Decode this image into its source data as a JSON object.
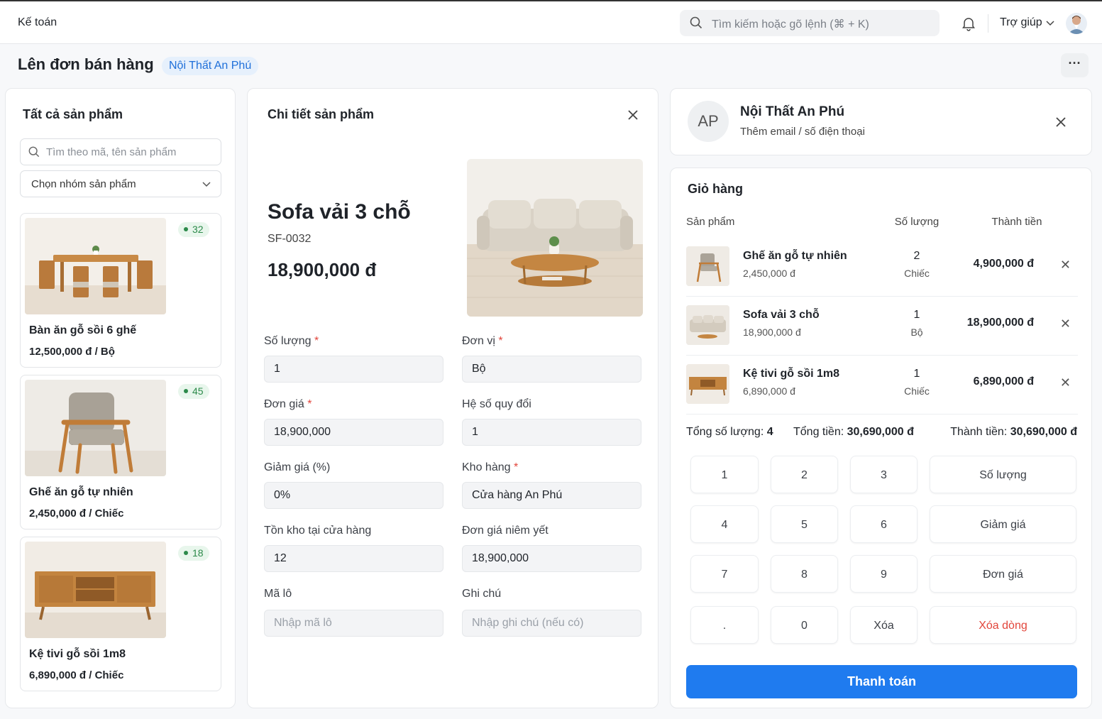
{
  "app": {
    "title": "Kế toán"
  },
  "search": {
    "placeholder": "Tìm kiếm hoặc gõ lệnh (⌘ + K)"
  },
  "help": {
    "label": "Trợ giúp"
  },
  "page": {
    "title": "Lên đơn bán hàng",
    "tag": "Nội Thất An Phú",
    "more": "···"
  },
  "products": {
    "title": "Tất cả sản phẩm",
    "search_placeholder": "Tìm theo mã, tên sản phẩm",
    "group_select": "Chọn nhóm sản phẩm",
    "items": [
      {
        "name": "Bàn ăn gỗ sồi 6 ghế",
        "price": "12,500,000 đ / Bộ",
        "stock": "32"
      },
      {
        "name": "Ghế ăn gỗ tự nhiên",
        "price": "2,450,000 đ / Chiếc",
        "stock": "45"
      },
      {
        "name": "Kệ tivi gỗ sồi 1m8",
        "price": "6,890,000 đ / Chiếc",
        "stock": "18"
      }
    ]
  },
  "detail": {
    "title": "Chi tiết sản phẩm",
    "name": "Sofa vải 3 chỗ",
    "sku": "SF-0032",
    "price": "18,900,000 đ",
    "fields": {
      "qty_label": "Số lượng",
      "qty": "1",
      "unit_label": "Đơn vị",
      "unit": "Bộ",
      "unit_price_label": "Đơn giá",
      "unit_price": "18,900,000",
      "factor_label": "Hệ số quy đổi",
      "factor": "1",
      "discount_label": "Giảm giá (%)",
      "discount": "0%",
      "warehouse_label": "Kho hàng",
      "warehouse": "Cửa hàng An Phú",
      "stock_label": "Tồn kho tại cửa hàng",
      "stock": "12",
      "list_price_label": "Đơn giá niêm yết",
      "list_price": "18,900,000",
      "lot_label": "Mã lô",
      "lot_placeholder": "Nhập mã lô",
      "note_label": "Ghi chú",
      "note_placeholder": "Nhập ghi chú (nếu có)"
    }
  },
  "customer": {
    "initials": "AP",
    "name": "Nội Thất An Phú",
    "sub": "Thêm email / số điện thoại"
  },
  "cart": {
    "title": "Giỏ hàng",
    "headers": {
      "product": "Sản phẩm",
      "qty": "Số lượng",
      "total": "Thành tiền"
    },
    "rows": [
      {
        "name": "Ghế ăn gỗ tự nhiên",
        "price": "2,450,000 đ",
        "qty": "2",
        "unit": "Chiếc",
        "total": "4,900,000 đ"
      },
      {
        "name": "Sofa vải 3 chỗ",
        "price": "18,900,000 đ",
        "qty": "1",
        "unit": "Bộ",
        "total": "18,900,000 đ"
      },
      {
        "name": "Kệ tivi gỗ sồi 1m8",
        "price": "6,890,000 đ",
        "qty": "1",
        "unit": "Chiếc",
        "total": "6,890,000 đ"
      }
    ],
    "summary": {
      "qty_label": "Tổng số lượng:",
      "qty": "4",
      "sum_label": "Tổng tiền:",
      "sum": "30,690,000 đ",
      "total_label": "Thành tiền:",
      "total": "30,690,000 đ"
    },
    "keypad": {
      "k1": "1",
      "k2": "2",
      "k3": "3",
      "k4": "4",
      "k5": "5",
      "k6": "6",
      "k7": "7",
      "k8": "8",
      "k9": "9",
      "kdot": ".",
      "k0": "0",
      "kdel": "Xóa",
      "qty": "Số lượng",
      "discount": "Giảm giá",
      "price": "Đơn giá",
      "delete_row": "Xóa dòng"
    },
    "pay": "Thanh toán"
  },
  "colors": {
    "accent": "#1f7bef",
    "danger": "#e2453b",
    "stock_badge": "#2c8a4a"
  }
}
